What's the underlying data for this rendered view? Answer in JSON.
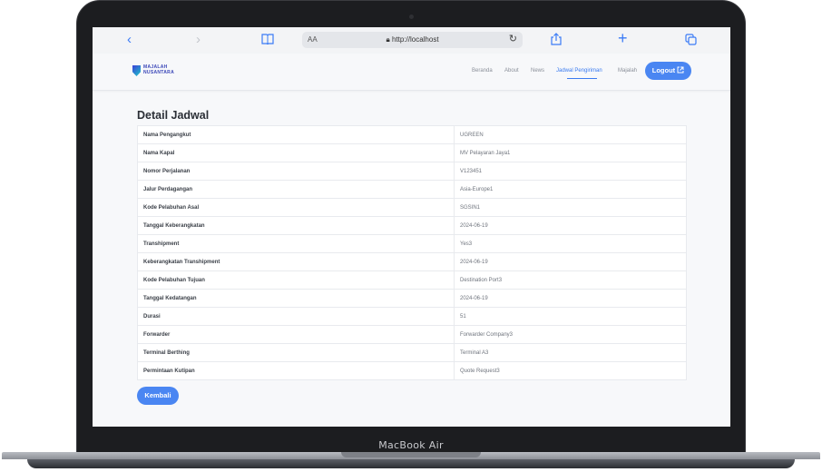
{
  "device": {
    "model_label": "MacBook Air"
  },
  "browser": {
    "reader_label": "AA",
    "url": "http://localhost",
    "icons": [
      "back-icon",
      "forward-icon",
      "book-icon",
      "lock-icon",
      "reload-icon",
      "share-icon",
      "plus-icon",
      "tabs-icon"
    ],
    "accent": "#3a7bf6"
  },
  "site": {
    "logo_line1": "MAJALAH",
    "logo_line2": "NUSANTARA",
    "menu": [
      "Beranda",
      "About",
      "News",
      "Jadwal Pengiriman",
      "Majalah"
    ],
    "active_menu": "Jadwal Pengiriman",
    "logout_label": "Logout",
    "accent": "#4a86f2"
  },
  "main": {
    "title": "Detail Jadwal",
    "rows": [
      {
        "label": "Nama Pengangkut",
        "value": "UGREEN"
      },
      {
        "label": "Nama Kapal",
        "value": "MV Pelayaran Jaya1"
      },
      {
        "label": "Nomor Perjalanan",
        "value": "V123451"
      },
      {
        "label": "Jalur Perdagangan",
        "value": "Asia-Europe1"
      },
      {
        "label": "Kode Pelabuhan Asal",
        "value": "SGSIN1"
      },
      {
        "label": "Tanggal Keberangkatan",
        "value": "2024-06-19"
      },
      {
        "label": "Transhipment",
        "value": "Yes3"
      },
      {
        "label": "Keberangkatan Transhipment",
        "value": "2024-06-19"
      },
      {
        "label": "Kode Pelabuhan Tujuan",
        "value": "Destination Port3"
      },
      {
        "label": "Tanggal Kedatangan",
        "value": "2024-06-19"
      },
      {
        "label": "Durasi",
        "value": "51"
      },
      {
        "label": "Forwarder",
        "value": "Forwarder Company3"
      },
      {
        "label": "Terminal Berthing",
        "value": "Terminal A3"
      },
      {
        "label": "Permintaan Kutipan",
        "value": "Quote Request3"
      }
    ],
    "back_label": "Kembali"
  }
}
